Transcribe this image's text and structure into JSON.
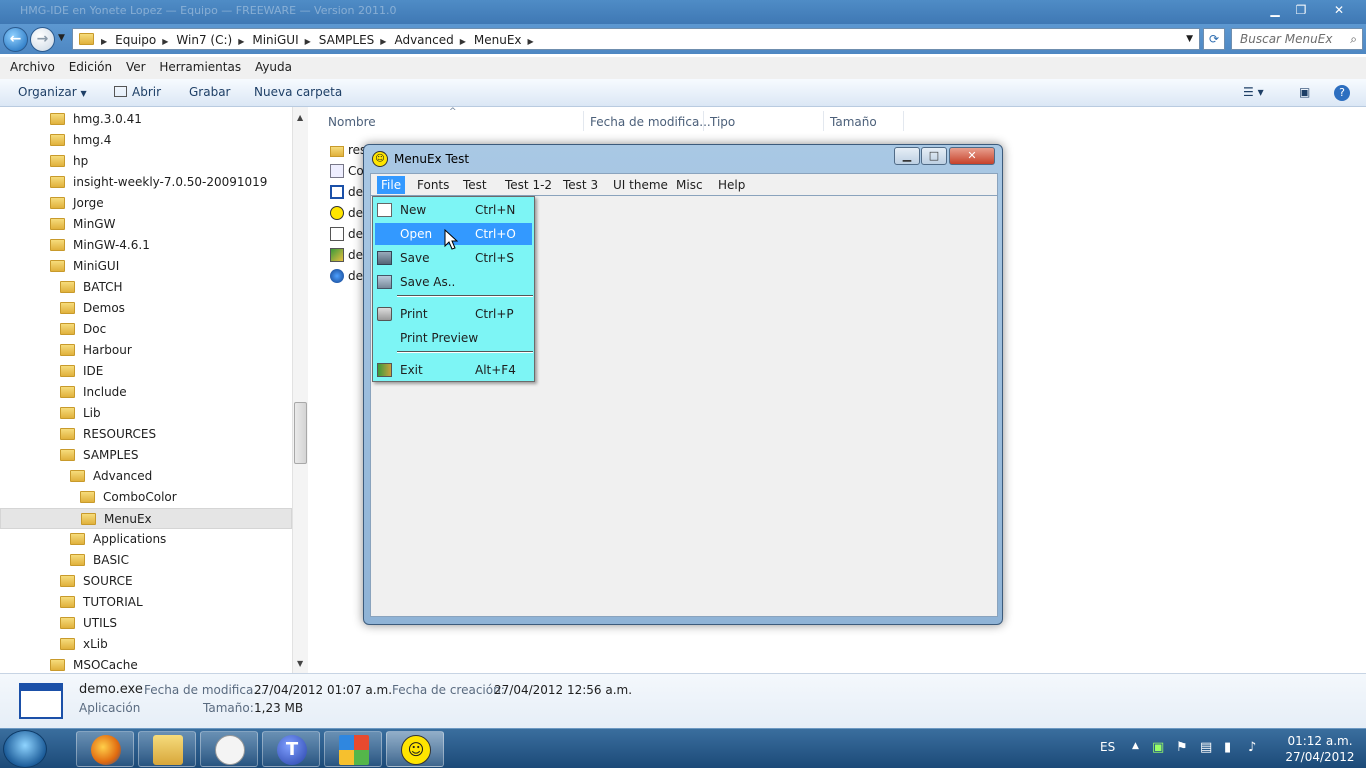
{
  "window": {
    "title_ghost": "HMG-IDE en Yonete Lopez — Equipo — FREEWARE — Version 2011.0"
  },
  "address": {
    "crumbs": [
      "Equipo",
      "Win7 (C:)",
      "MiniGUI",
      "SAMPLES",
      "Advanced",
      "MenuEx"
    ],
    "search_placeholder": "Buscar MenuEx"
  },
  "menubar": [
    "Archivo",
    "Edición",
    "Ver",
    "Herramientas",
    "Ayuda"
  ],
  "commands": {
    "organize": "Organizar",
    "open": "Abrir",
    "burn": "Grabar",
    "new_folder": "Nueva carpeta"
  },
  "tree": [
    {
      "label": "hmg.3.0.41",
      "indent": 0
    },
    {
      "label": "hmg.4",
      "indent": 0
    },
    {
      "label": "hp",
      "indent": 0
    },
    {
      "label": "insight-weekly-7.0.50-20091019",
      "indent": 0
    },
    {
      "label": "Jorge",
      "indent": 0
    },
    {
      "label": "MinGW",
      "indent": 0
    },
    {
      "label": "MinGW-4.6.1",
      "indent": 0
    },
    {
      "label": "MiniGUI",
      "indent": 0
    },
    {
      "label": "BATCH",
      "indent": 1
    },
    {
      "label": "Demos",
      "indent": 1
    },
    {
      "label": "Doc",
      "indent": 1
    },
    {
      "label": "Harbour",
      "indent": 1
    },
    {
      "label": "IDE",
      "indent": 1
    },
    {
      "label": "Include",
      "indent": 1
    },
    {
      "label": "Lib",
      "indent": 1
    },
    {
      "label": "RESOURCES",
      "indent": 1
    },
    {
      "label": "SAMPLES",
      "indent": 1
    },
    {
      "label": "Advanced",
      "indent": 2
    },
    {
      "label": "ComboColor",
      "indent": 3
    },
    {
      "label": "MenuEx",
      "indent": 3,
      "selected": true
    },
    {
      "label": "Applications",
      "indent": 2
    },
    {
      "label": "BASIC",
      "indent": 2
    },
    {
      "label": "SOURCE",
      "indent": 1
    },
    {
      "label": "TUTORIAL",
      "indent": 1
    },
    {
      "label": "UTILS",
      "indent": 1
    },
    {
      "label": "xLib",
      "indent": 1
    },
    {
      "label": "MSOCache",
      "indent": 0
    }
  ],
  "columns": {
    "name": "Nombre",
    "date": "Fecha de modifica...",
    "type": "Tipo",
    "size": "Tamaño"
  },
  "files": [
    {
      "name": "res",
      "icon": "folder-icon"
    },
    {
      "name": "Co",
      "icon": "config-file-icon"
    },
    {
      "name": "de",
      "icon": "window-file-icon"
    },
    {
      "name": "de",
      "icon": "smiley-icon"
    },
    {
      "name": "de",
      "icon": "script-file-icon"
    },
    {
      "name": "de",
      "icon": "image-file-icon"
    },
    {
      "name": "de",
      "icon": "globe-icon"
    }
  ],
  "details": {
    "filename": "demo.exe",
    "type": "Aplicación",
    "modified_label": "Fecha de modifica...",
    "modified_value": "27/04/2012 01:07 a.m.",
    "created_label": "Fecha de creación:",
    "created_value": "27/04/2012 12:56 a.m.",
    "size_label": "Tamaño:",
    "size_value": "1,23 MB"
  },
  "app": {
    "title": "MenuEx Test",
    "menu": [
      "File",
      "Fonts",
      "Test",
      "Test 1-2",
      "Test 3",
      "UI theme",
      "Misc",
      "Help"
    ],
    "active_menu": "File",
    "popup_bg": "#7df5f5",
    "highlight": "#3399ff",
    "items": [
      {
        "label": "New",
        "shortcut": "Ctrl+N",
        "icon": "new-document-icon"
      },
      {
        "label": "Open",
        "shortcut": "Ctrl+O",
        "icon": "",
        "highlighted": true
      },
      {
        "label": "Save",
        "shortcut": "Ctrl+S",
        "icon": "save-icon"
      },
      {
        "label": "Save As..",
        "shortcut": "",
        "icon": "save-as-icon"
      },
      {
        "label": "Print",
        "shortcut": "Ctrl+P",
        "icon": "printer-icon"
      },
      {
        "label": "Print Preview",
        "shortcut": "",
        "icon": ""
      },
      {
        "label": "Exit",
        "shortcut": "Alt+F4",
        "icon": "exit-icon"
      }
    ]
  },
  "tray": {
    "lang": "ES",
    "time": "01:12 a.m.",
    "date": "27/04/2012"
  }
}
